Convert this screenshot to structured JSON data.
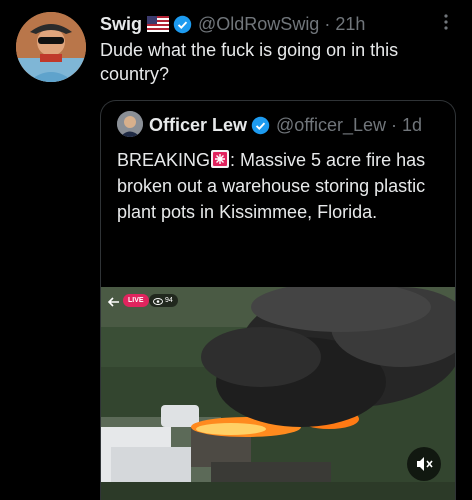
{
  "tweet": {
    "display_name": "Swig",
    "handle": "@OldRowSwig",
    "separator": "·",
    "time": "21h",
    "text": "Dude what the fuck is going on in this country?"
  },
  "quoted_tweet": {
    "display_name": "Officer Lew",
    "handle": "@officer_Lew",
    "separator": "·",
    "time": "1d",
    "text_before_emoji": "BREAKING",
    "text_after_emoji": ": Massive 5 acre fire has broken out a warehouse storing plastic plant pots in Kissimmee, Florida.",
    "ellipsis": "..."
  },
  "media": {
    "live_label": "LIVE",
    "viewer_count": "94"
  },
  "colors": {
    "background": "#000000",
    "text": "#e7e9ea",
    "muted": "#71767b",
    "verified": "#1d9bf0",
    "live": "#e0245e",
    "border": "#2f3336"
  }
}
